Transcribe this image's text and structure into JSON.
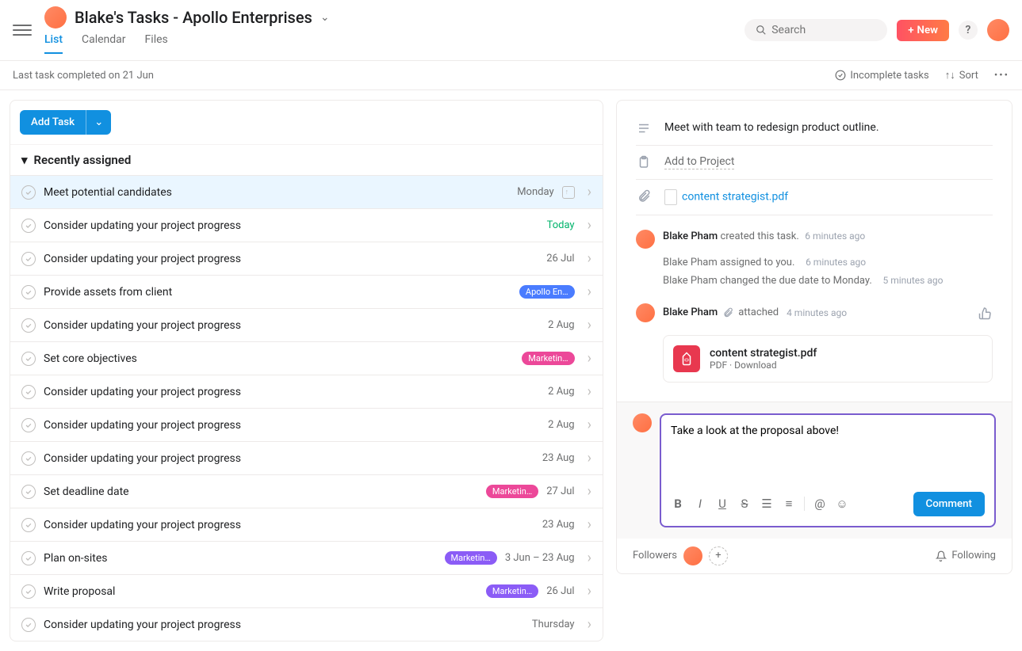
{
  "header": {
    "title": "Blake's Tasks - Apollo Enterprises",
    "tabs": [
      "List",
      "Calendar",
      "Files"
    ],
    "activeTab": 0,
    "searchPlaceholder": "Search",
    "newLabel": "New"
  },
  "subbar": {
    "lastCompleted": "Last task completed on 21 Jun",
    "filter": "Incomplete tasks",
    "sort": "Sort"
  },
  "taskList": {
    "addTask": "Add Task",
    "sectionTitle": "Recently assigned",
    "tasks": [
      {
        "title": "Meet potential candidates",
        "date": "Monday",
        "selected": true,
        "hasCalUp": true
      },
      {
        "title": "Consider updating your project progress",
        "date": "Today",
        "dateClass": "today"
      },
      {
        "title": "Consider updating your project progress",
        "date": "26 Jul"
      },
      {
        "title": "Provide assets from client",
        "tag": "Apollo En…",
        "tagColor": "#4a7cff"
      },
      {
        "title": "Consider updating your project progress",
        "date": "2 Aug"
      },
      {
        "title": "Set core objectives",
        "tag": "Marketin…",
        "tagColor": "#ec4899"
      },
      {
        "title": "Consider updating your project progress",
        "date": "2 Aug"
      },
      {
        "title": "Consider updating your project progress",
        "date": "2 Aug"
      },
      {
        "title": "Consider updating your project progress",
        "date": "23 Aug"
      },
      {
        "title": "Set deadline date",
        "tag": "Marketin…",
        "tagColor": "#ec4899",
        "date": "27 Jul"
      },
      {
        "title": "Consider updating your project progress",
        "date": "23 Aug"
      },
      {
        "title": "Plan on-sites",
        "tag": "Marketin…",
        "tagColor": "#8b5cf6",
        "date": "3 Jun – 23 Aug"
      },
      {
        "title": "Write proposal",
        "tag": "Marketin…",
        "tagColor": "#8b5cf6",
        "date": "26 Jul"
      },
      {
        "title": "Consider updating your project progress",
        "date": "Thursday"
      }
    ]
  },
  "detail": {
    "description": "Meet with team to redesign product outline.",
    "addProject": "Add to Project",
    "attachment": "content strategist.pdf",
    "activity": {
      "creator": "Blake Pham",
      "createdAction": "created this task.",
      "createdTime": "6 minutes ago",
      "sub1": "Blake Pham assigned to you.",
      "sub1Time": "6 minutes ago",
      "sub2": "Blake Pham changed the due date to Monday.",
      "sub2Time": "5 minutes ago",
      "attacher": "Blake Pham",
      "attachAction": "attached",
      "attachTime": "4 minutes ago",
      "attachFile": "content strategist.pdf",
      "attachMeta": "PDF · Download"
    },
    "comment": {
      "value": "Take a look at the proposal above!",
      "button": "Comment"
    },
    "followers": "Followers",
    "following": "Following"
  }
}
